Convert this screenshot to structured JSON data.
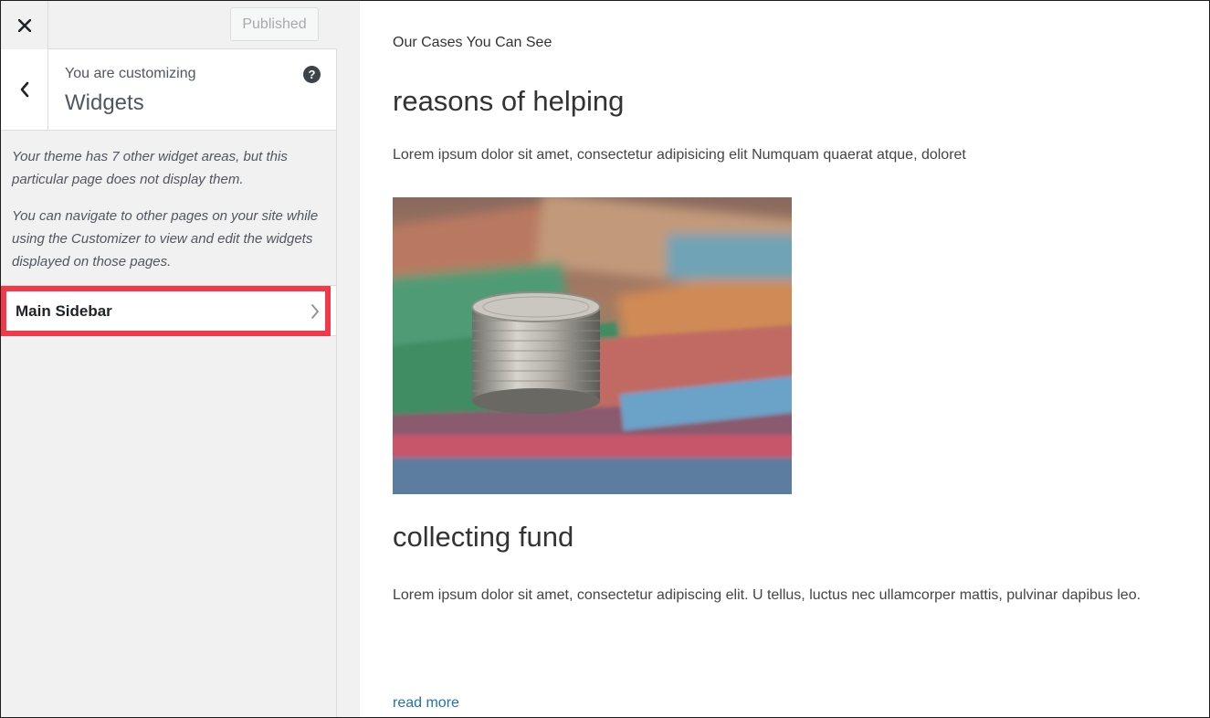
{
  "customizer": {
    "topbar": {
      "close_icon": "close-icon",
      "publish_label": "Published"
    },
    "panel": {
      "back_icon": "chevron-left-icon",
      "customizing_label": "You are customizing",
      "title": "Widgets",
      "help_icon": "help-icon",
      "help_glyph": "?"
    },
    "notice": {
      "paragraph_1": "Your theme has 7 other widget areas, but this particular page does not display them.",
      "paragraph_2": "You can navigate to other pages on your site while using the Customizer to view and edit the widgets displayed on those pages."
    },
    "sections": [
      {
        "label": "Main Sidebar",
        "icon": "chevron-right-icon",
        "highlighted": true,
        "highlight_color": "#f2394a"
      }
    ]
  },
  "preview": {
    "eyebrow": "Our Cases You Can See",
    "heading_1": "reasons of helping",
    "paragraph_1": "Lorem ipsum dolor sit amet, consectetur adipisicing elit Numquam quaerat atque, doloret",
    "image_icon": "coins-on-banknotes-photo",
    "heading_2": "collecting fund",
    "paragraph_2": "Lorem ipsum dolor sit amet, consectetur adipiscing elit. U tellus, luctus nec ullamcorper mattis, pulvinar dapibus leo.",
    "read_more": "read more"
  },
  "colors": {
    "accent_link": "#2271b1",
    "highlight_border": "#f2394a",
    "sidebar_bg": "#f1f1f1"
  }
}
